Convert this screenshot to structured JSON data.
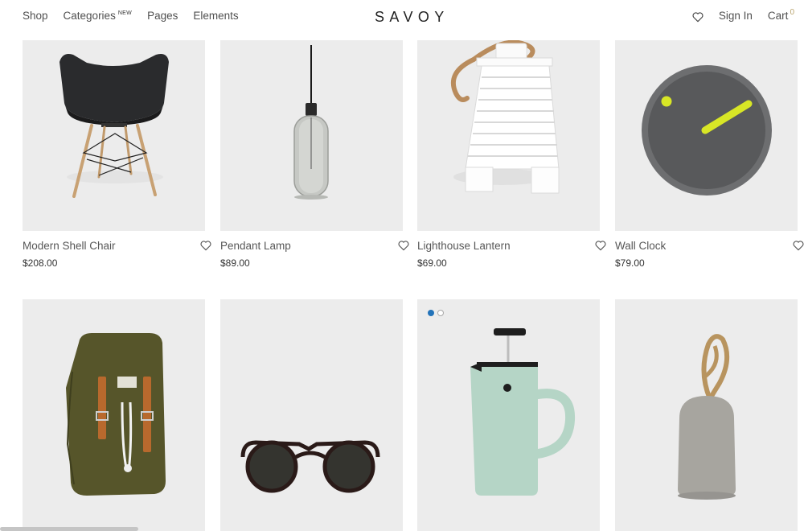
{
  "header": {
    "nav": [
      {
        "label": "Shop"
      },
      {
        "label": "Categories",
        "badge": "NEW"
      },
      {
        "label": "Pages"
      },
      {
        "label": "Elements"
      }
    ],
    "logo": "SAVOY",
    "sign_in": "Sign In",
    "cart_label": "Cart",
    "cart_count": "0",
    "wishlist_icon": "heart-icon"
  },
  "products": [
    {
      "name": "Modern Shell Chair",
      "price": "$208.00"
    },
    {
      "name": "Pendant Lamp",
      "price": "$89.00"
    },
    {
      "name": "Lighthouse Lantern",
      "price": "$69.00"
    },
    {
      "name": "Wall Clock",
      "price": "$79.00"
    },
    {
      "name": "Backpack"
    },
    {
      "name": "Sunglasses"
    },
    {
      "name": "French Press"
    },
    {
      "name": "Rope Doorstop"
    }
  ],
  "colors": {
    "accent": "#b9a46f",
    "image_bg": "#ececec",
    "dot_active": "#2373b9"
  }
}
